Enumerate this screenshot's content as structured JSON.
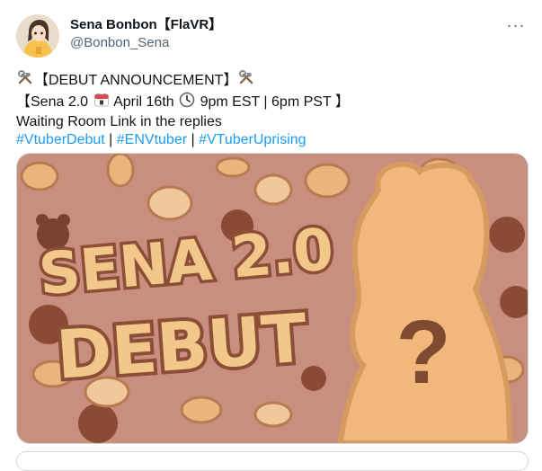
{
  "tweet": {
    "display_name": "Sena Bonbon【FlaVR】",
    "handle": "@Bonbon_Sena",
    "more_icon": "more-horizontal-icon",
    "line1_text": "【DEBUT ANNOUNCEMENT】",
    "line2_a": "【Sena 2.0",
    "line2_b": "April 16th",
    "line2_c": "9pm EST | 6pm PST 】",
    "line3": "Waiting Room Link in the replies",
    "hashtags": [
      "#VtuberDebut",
      "#ENVtuber",
      "#VTuberUprising"
    ],
    "hashtag_separator": " | "
  },
  "media": {
    "title_line1": "SENA 2.0",
    "title_line2": "DEBUT",
    "mystery_mark": "?",
    "colors": {
      "background": "#c98f7e",
      "title_fill": "#f3c68a",
      "title_stroke": "#8a4f36",
      "silhouette": "#f2b77b"
    }
  }
}
